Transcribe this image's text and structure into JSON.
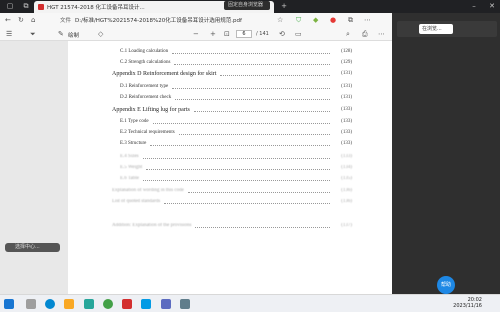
{
  "browser": {
    "tab_title": "HGT 21574-2018 化工设备吊耳设计...",
    "address": "D:/标准/HGT%2021574-2018%20化工设备吊耳设计选用规范.pdf",
    "file_label": "文件",
    "extension_label": "固定自身浏览器"
  },
  "pdf_toolbar": {
    "draw_label": "绘制",
    "page_current": "6",
    "page_total": "/ 141"
  },
  "right_panel": {
    "button_label": "在浏览..."
  },
  "toc": [
    {
      "title": "C.1   Loading calculation",
      "page": "(128)",
      "level": 2
    },
    {
      "title": "C.2   Strength calculations",
      "page": "(129)",
      "level": 2
    },
    {
      "title": "Appendix D   Reinforcement design for skirt",
      "page": "(131)",
      "level": 1
    },
    {
      "title": "D.1   Reinforcement type",
      "page": "(131)",
      "level": 2
    },
    {
      "title": "D.2   Reinforcement check",
      "page": "(131)",
      "level": 2
    },
    {
      "title": "Appendix E   Lifting lug for parts",
      "page": "(133)",
      "level": 1
    },
    {
      "title": "E.1   Type code",
      "page": "(133)",
      "level": 2
    },
    {
      "title": "E.2   Technical requirements",
      "page": "(133)",
      "level": 2
    },
    {
      "title": "E.3   Structure",
      "page": "(133)",
      "level": 2
    },
    {
      "title": "E.4   Sizes",
      "page": "(133)",
      "level": 2,
      "faded": true
    },
    {
      "title": "E.5   Weight",
      "page": "(134)",
      "level": 2,
      "faded": true
    },
    {
      "title": "E.6   Table",
      "page": "(135)",
      "level": 2,
      "faded": true
    },
    {
      "title": "Explanation of wording in this code",
      "page": "(136)",
      "level": 0,
      "faded": true
    },
    {
      "title": "List of quoted standards",
      "page": "(136)",
      "level": 0,
      "faded": true
    },
    {
      "title": "Addition: Explanation of the provisions",
      "page": "(137)",
      "level": 0,
      "faded": true
    }
  ],
  "toast": {
    "label": "选择中心..."
  },
  "fab": {
    "label": "帮助"
  },
  "clock": {
    "time": "20:02",
    "date": "2023/11/16"
  }
}
